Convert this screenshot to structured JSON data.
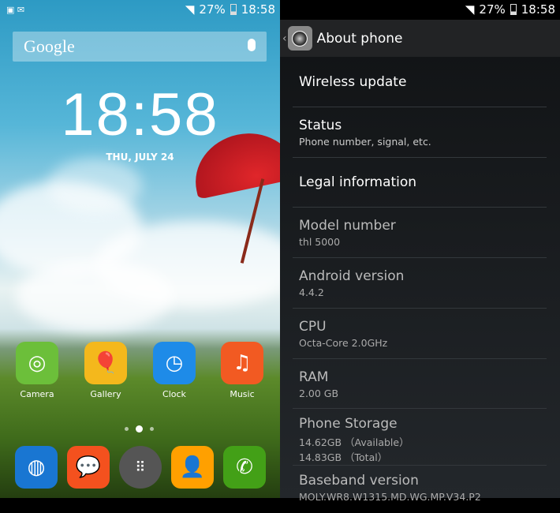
{
  "home": {
    "status_bar": {
      "battery": "27%",
      "time": "18:58"
    },
    "search": {
      "logo": "Google",
      "icon": "microphone-icon"
    },
    "clock": {
      "time": "18:58",
      "date": "THU, JULY 24"
    },
    "apps": [
      {
        "label": "Camera",
        "color": "#6cbf3a"
      },
      {
        "label": "Gallery",
        "color": "#f4b81c"
      },
      {
        "label": "Clock",
        "color": "#1e8be8"
      },
      {
        "label": "Music",
        "color": "#f25a22"
      }
    ],
    "dock": [
      {
        "name": "browser",
        "color": "#1976d2"
      },
      {
        "name": "messaging",
        "color": "#f4511e"
      },
      {
        "name": "app-drawer",
        "color": "#555"
      },
      {
        "name": "contacts",
        "color": "#ffa000"
      },
      {
        "name": "phone",
        "color": "#43a017"
      }
    ]
  },
  "settings": {
    "status_bar": {
      "battery": "27%",
      "time": "18:58"
    },
    "title": "About phone",
    "items": [
      {
        "title": "Wireless update",
        "summary": ""
      },
      {
        "title": "Status",
        "summary": "Phone number, signal, etc."
      },
      {
        "title": "Legal information",
        "summary": ""
      },
      {
        "title": "Model number",
        "summary": "thl 5000"
      },
      {
        "title": "Android version",
        "summary": "4.4.2"
      },
      {
        "title": "CPU",
        "summary": "Octa-Core 2.0GHz"
      },
      {
        "title": "RAM",
        "summary": "2.00 GB"
      },
      {
        "title": "Phone Storage",
        "summary": "14.62GB （Available）",
        "summary2": "14.83GB （Total）"
      },
      {
        "title": "Baseband version",
        "summary": "MOLY.WR8.W1315.MD.WG.MP.V34.P2"
      }
    ]
  }
}
